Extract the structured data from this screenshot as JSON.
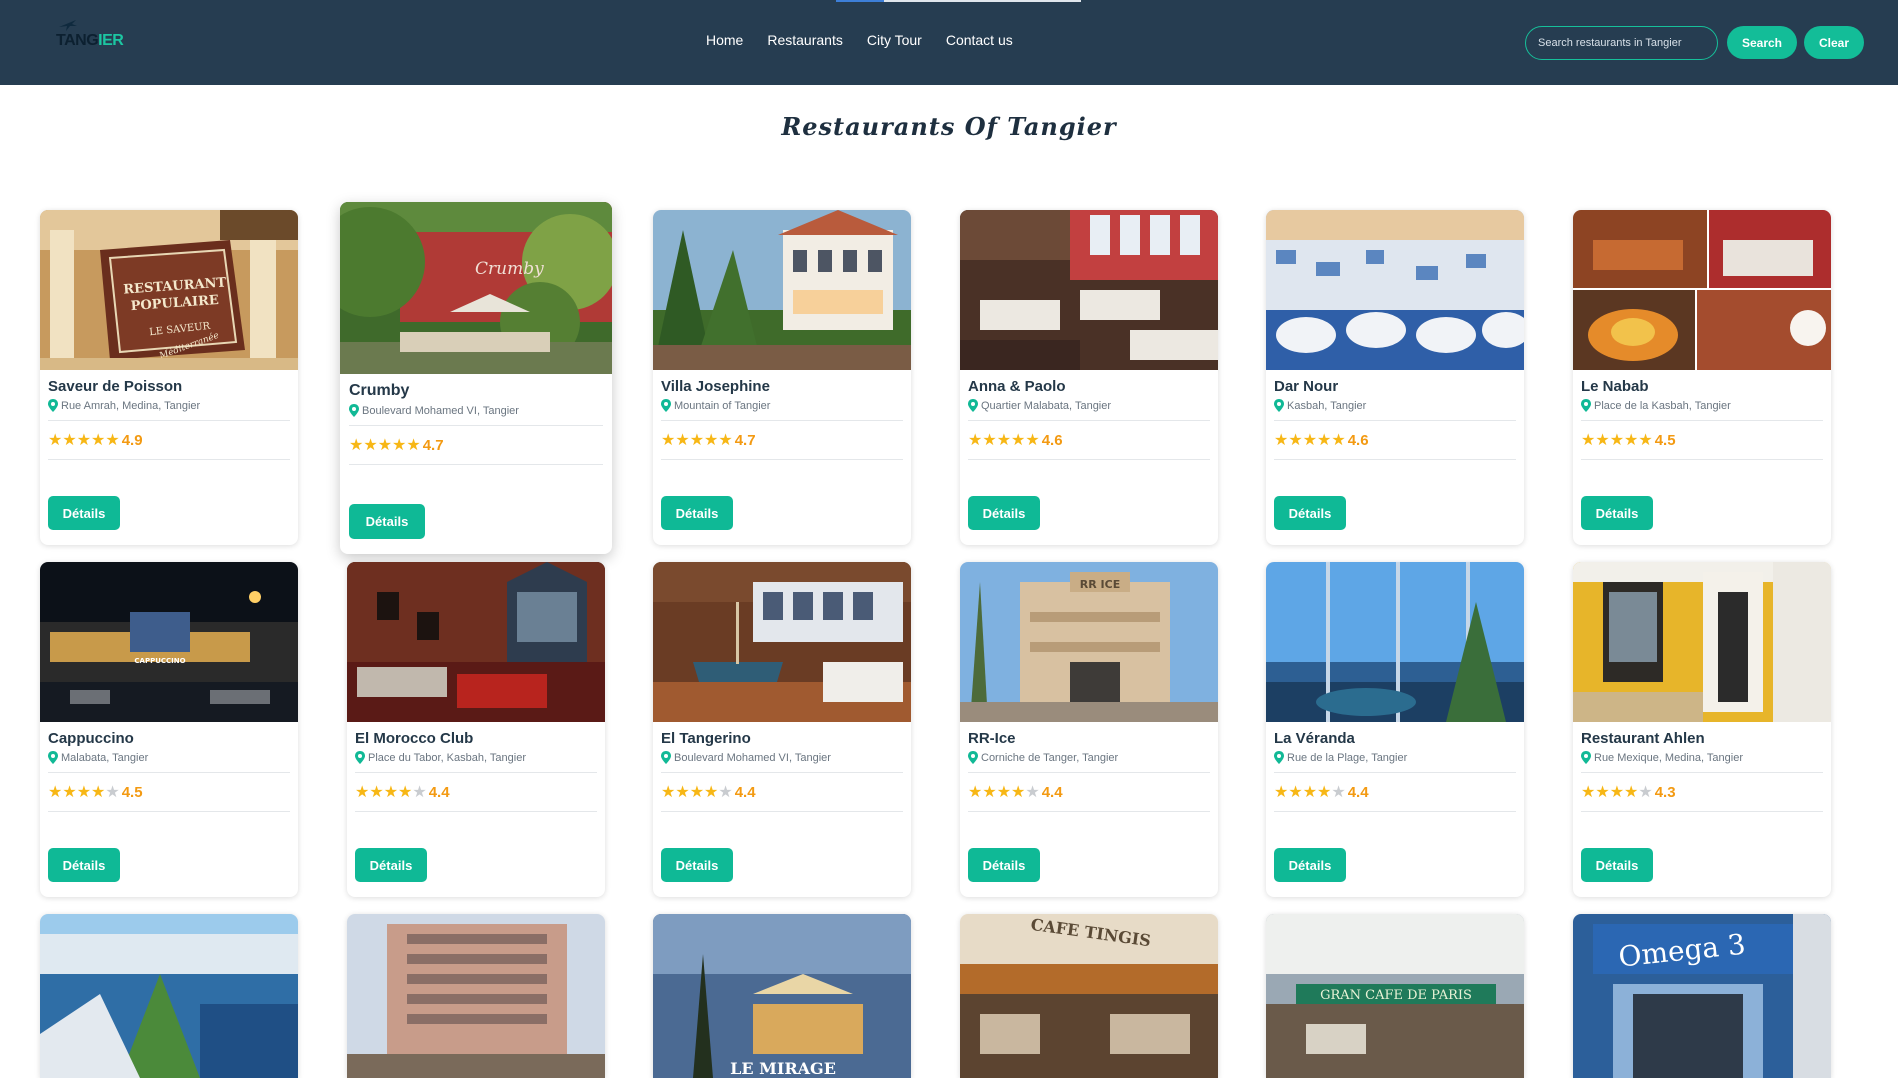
{
  "header": {
    "logo": {
      "part1": "TANG",
      "part2": "IER"
    },
    "nav": [
      "Home",
      "Restaurants",
      "City Tour",
      "Contact us"
    ],
    "search_placeholder": "Search restaurants in Tangier",
    "search_label": "Search",
    "clear_label": "Clear"
  },
  "page_title": "Restaurants Of Tangier",
  "details_label": "Détails",
  "restaurants": [
    {
      "name": "Saveur de Poisson",
      "location": "Rue Amrah, Medina, Tangier",
      "rating": "4.9",
      "stars": 5
    },
    {
      "name": "Crumby",
      "location": "Boulevard Mohamed VI, Tangier",
      "rating": "4.7",
      "stars": 5
    },
    {
      "name": "Villa Josephine",
      "location": "Mountain of Tangier",
      "rating": "4.7",
      "stars": 5
    },
    {
      "name": "Anna & Paolo",
      "location": "Quartier Malabata, Tangier",
      "rating": "4.6",
      "stars": 5
    },
    {
      "name": "Dar Nour",
      "location": "Kasbah, Tangier",
      "rating": "4.6",
      "stars": 5
    },
    {
      "name": "Le Nabab",
      "location": "Place de la Kasbah, Tangier",
      "rating": "4.5",
      "stars": 5
    },
    {
      "name": "Cappuccino",
      "location": "Malabata, Tangier",
      "rating": "4.5",
      "stars": 4
    },
    {
      "name": "El Morocco Club",
      "location": "Place du Tabor, Kasbah, Tangier",
      "rating": "4.4",
      "stars": 4
    },
    {
      "name": "El Tangerino",
      "location": "Boulevard Mohamed VI, Tangier",
      "rating": "4.4",
      "stars": 4
    },
    {
      "name": "RR-Ice",
      "location": "Corniche de Tanger, Tangier",
      "rating": "4.4",
      "stars": 4
    },
    {
      "name": "La Véranda",
      "location": "Rue de la Plage, Tangier",
      "rating": "4.4",
      "stars": 4
    },
    {
      "name": "Restaurant Ahlen",
      "location": "Rue Mexique, Medina, Tangier",
      "rating": "4.3",
      "stars": 4
    }
  ],
  "photo_signs": {
    "saveur": [
      "RESTAURANT",
      "POPULAIRE",
      "LE SAVEUR",
      "Méditerranée"
    ],
    "crumby": "Crumby",
    "cappuccino": "CAPPUCCINO",
    "rrice": "RR ICE",
    "mirage": "LE MIRAGE",
    "cafe_tingis": "CAFE TINGIS",
    "gran_cafe": "GRAN CAFE DE PARIS",
    "omega": "Omega 3"
  }
}
